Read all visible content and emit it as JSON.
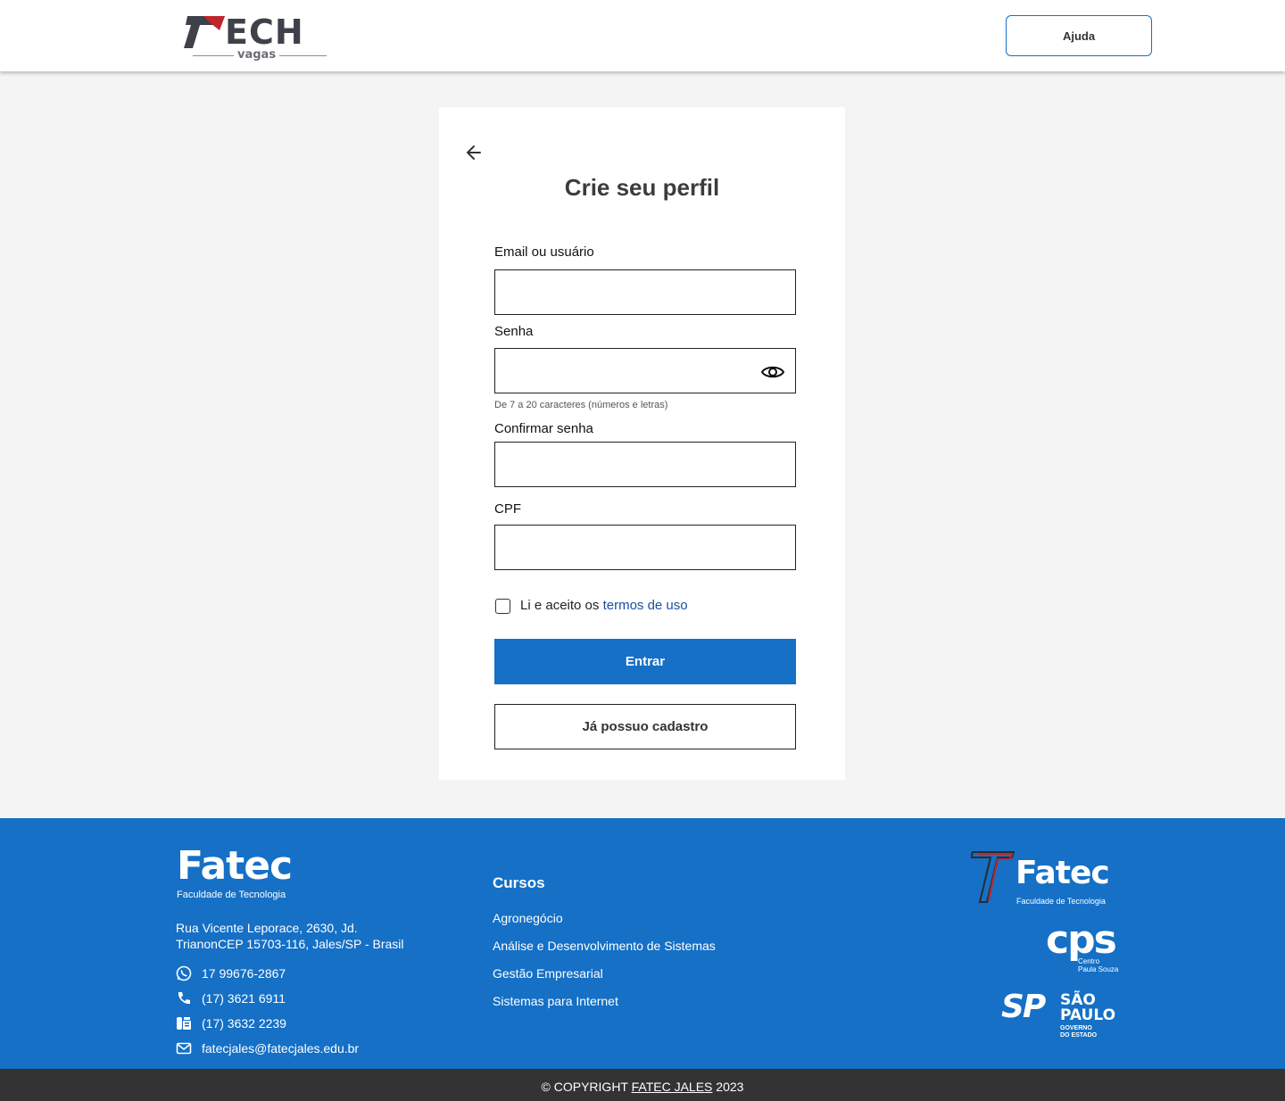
{
  "header": {
    "logo_main": "ECH",
    "logo_sub": "vagas",
    "help_label": "Ajuda"
  },
  "form": {
    "title": "Crie seu perfil",
    "email_label": "Email ou usuário",
    "email_value": "",
    "password_label": "Senha",
    "password_value": "",
    "password_hint": "De 7 a 20 caracteres (números e letras)",
    "confirm_label": "Confirmar senha",
    "confirm_value": "",
    "cpf_label": "CPF",
    "cpf_value": "",
    "terms_prefix": "Li e aceito os",
    "terms_link": "termos de uso",
    "terms_checked": false,
    "submit_label": "Entrar",
    "existing_label": "Já possuo cadastro"
  },
  "footer": {
    "brand": "Fatec",
    "brand_sub": "Faculdade de Tecnologia",
    "address_line1": "Rua Vicente Leporace, 2630, Jd.",
    "address_line2": "TrianonCEP 15703-116, Jales/SP - Brasil",
    "contacts": [
      {
        "icon": "whatsapp-icon",
        "text": "17 99676-2867"
      },
      {
        "icon": "phone-icon",
        "text": "(17) 3621 6911"
      },
      {
        "icon": "fax-icon",
        "text": "(17) 3632 2239"
      },
      {
        "icon": "mail-icon",
        "text": "fatecjales@fatecjales.edu.br"
      }
    ],
    "courses_title": "Cursos",
    "courses": [
      "Agronegócio",
      "Análise e Desenvolvimento de Sistemas",
      "Gestão Empresarial",
      "Sistemas para Internet"
    ],
    "right_fatec": "Fatec",
    "right_fatec_sub": "Faculdade de Tecnologia",
    "cps": "cps",
    "cps_sub1": "Centro",
    "cps_sub2": "Paula Souza",
    "sp_mark": "SP",
    "sp_line1": "SÃO",
    "sp_line2": "PAULO",
    "sp_gov1": "GOVERNO",
    "sp_gov2": "DO ESTADO"
  },
  "copyright": {
    "prefix": "© COPYRIGHT",
    "link": "FATEC JALES",
    "year": "2023"
  },
  "colors": {
    "primary": "#1570c6",
    "logo_red": "#c0262d",
    "logo_dark": "#3e4149",
    "copyright_bg": "#333333"
  }
}
